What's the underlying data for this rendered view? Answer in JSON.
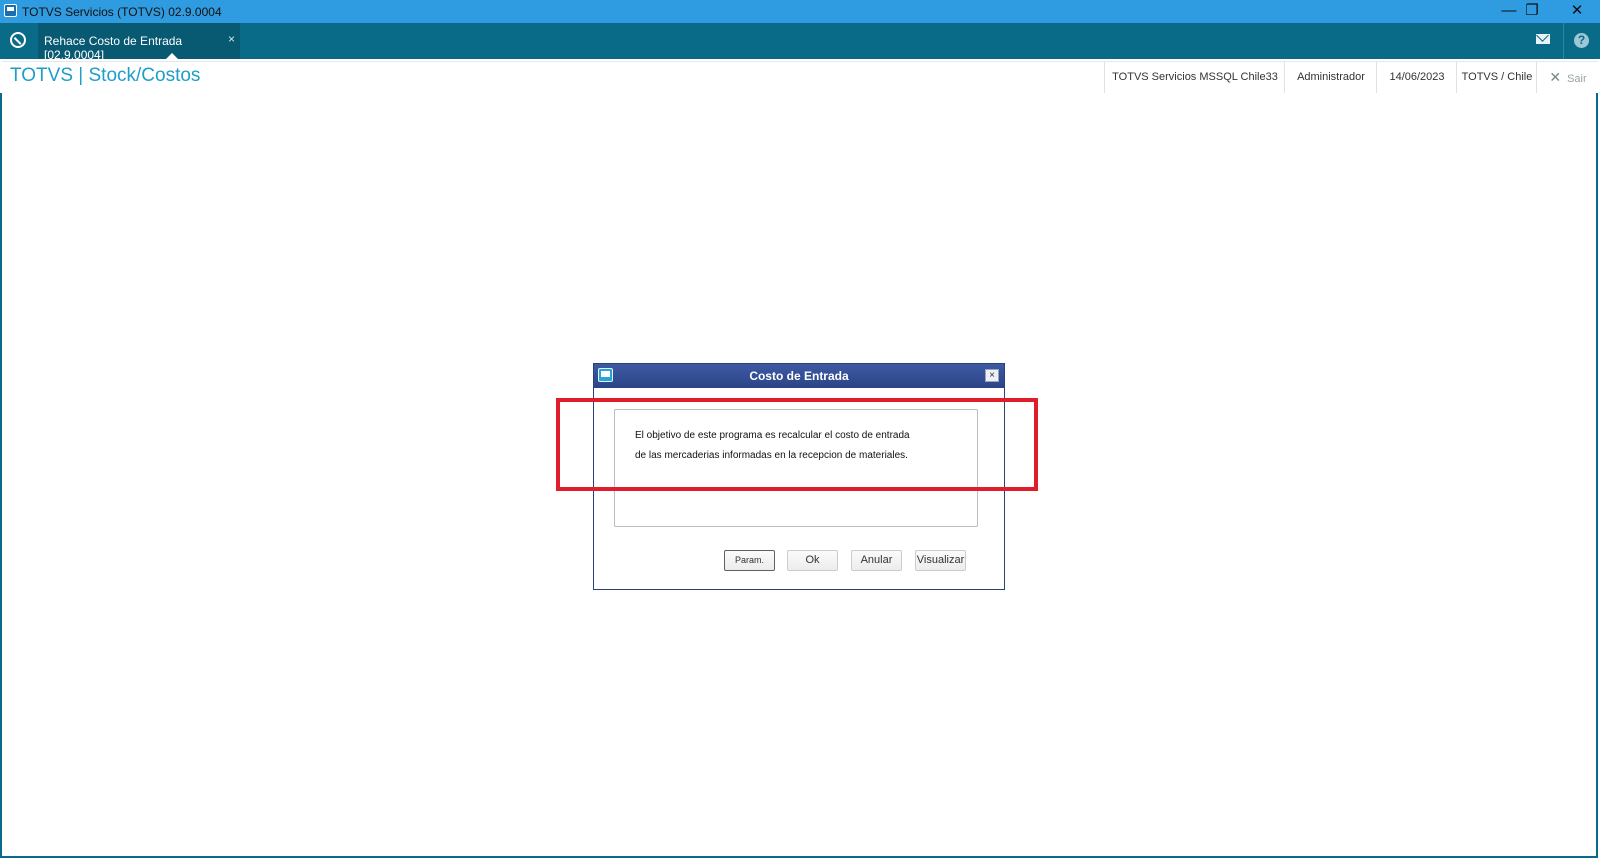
{
  "window": {
    "title": "TOTVS Servicios (TOTVS) 02.9.0004",
    "minimize_glyph": "—",
    "restore_glyph": "❐",
    "close_glyph": "✕"
  },
  "tabbar": {
    "active_tab": "Rehace Costo de Entrada [02.9.0004]",
    "tab_close_glyph": "×",
    "help_glyph": "?"
  },
  "header": {
    "module_title": "TOTVS | Stock/Costos",
    "environment": "TOTVS Servicios MSSQL Chile33",
    "user": "Administrador",
    "date": "14/06/2023",
    "company": "TOTVS / Chile",
    "exit_label": "Sair",
    "exit_glyph": "✕"
  },
  "dialog": {
    "title": "Costo de Entrada",
    "close_glyph": "×",
    "message_lines": [
      "El objetivo de este programa es recalcular el costo de entrada",
      "de las mercaderias informadas en la recepcion de materiales."
    ],
    "buttons": {
      "param": "Param.",
      "ok": "Ok",
      "anular": "Anular",
      "visualizar": "Visualizar"
    }
  },
  "colors": {
    "titlebar": "#2f9be0",
    "tabbar": "#0a6b88",
    "module_title": "#1e9ec9",
    "dialog_titlebar": "#2b4487",
    "highlight": "#e01d2b"
  }
}
